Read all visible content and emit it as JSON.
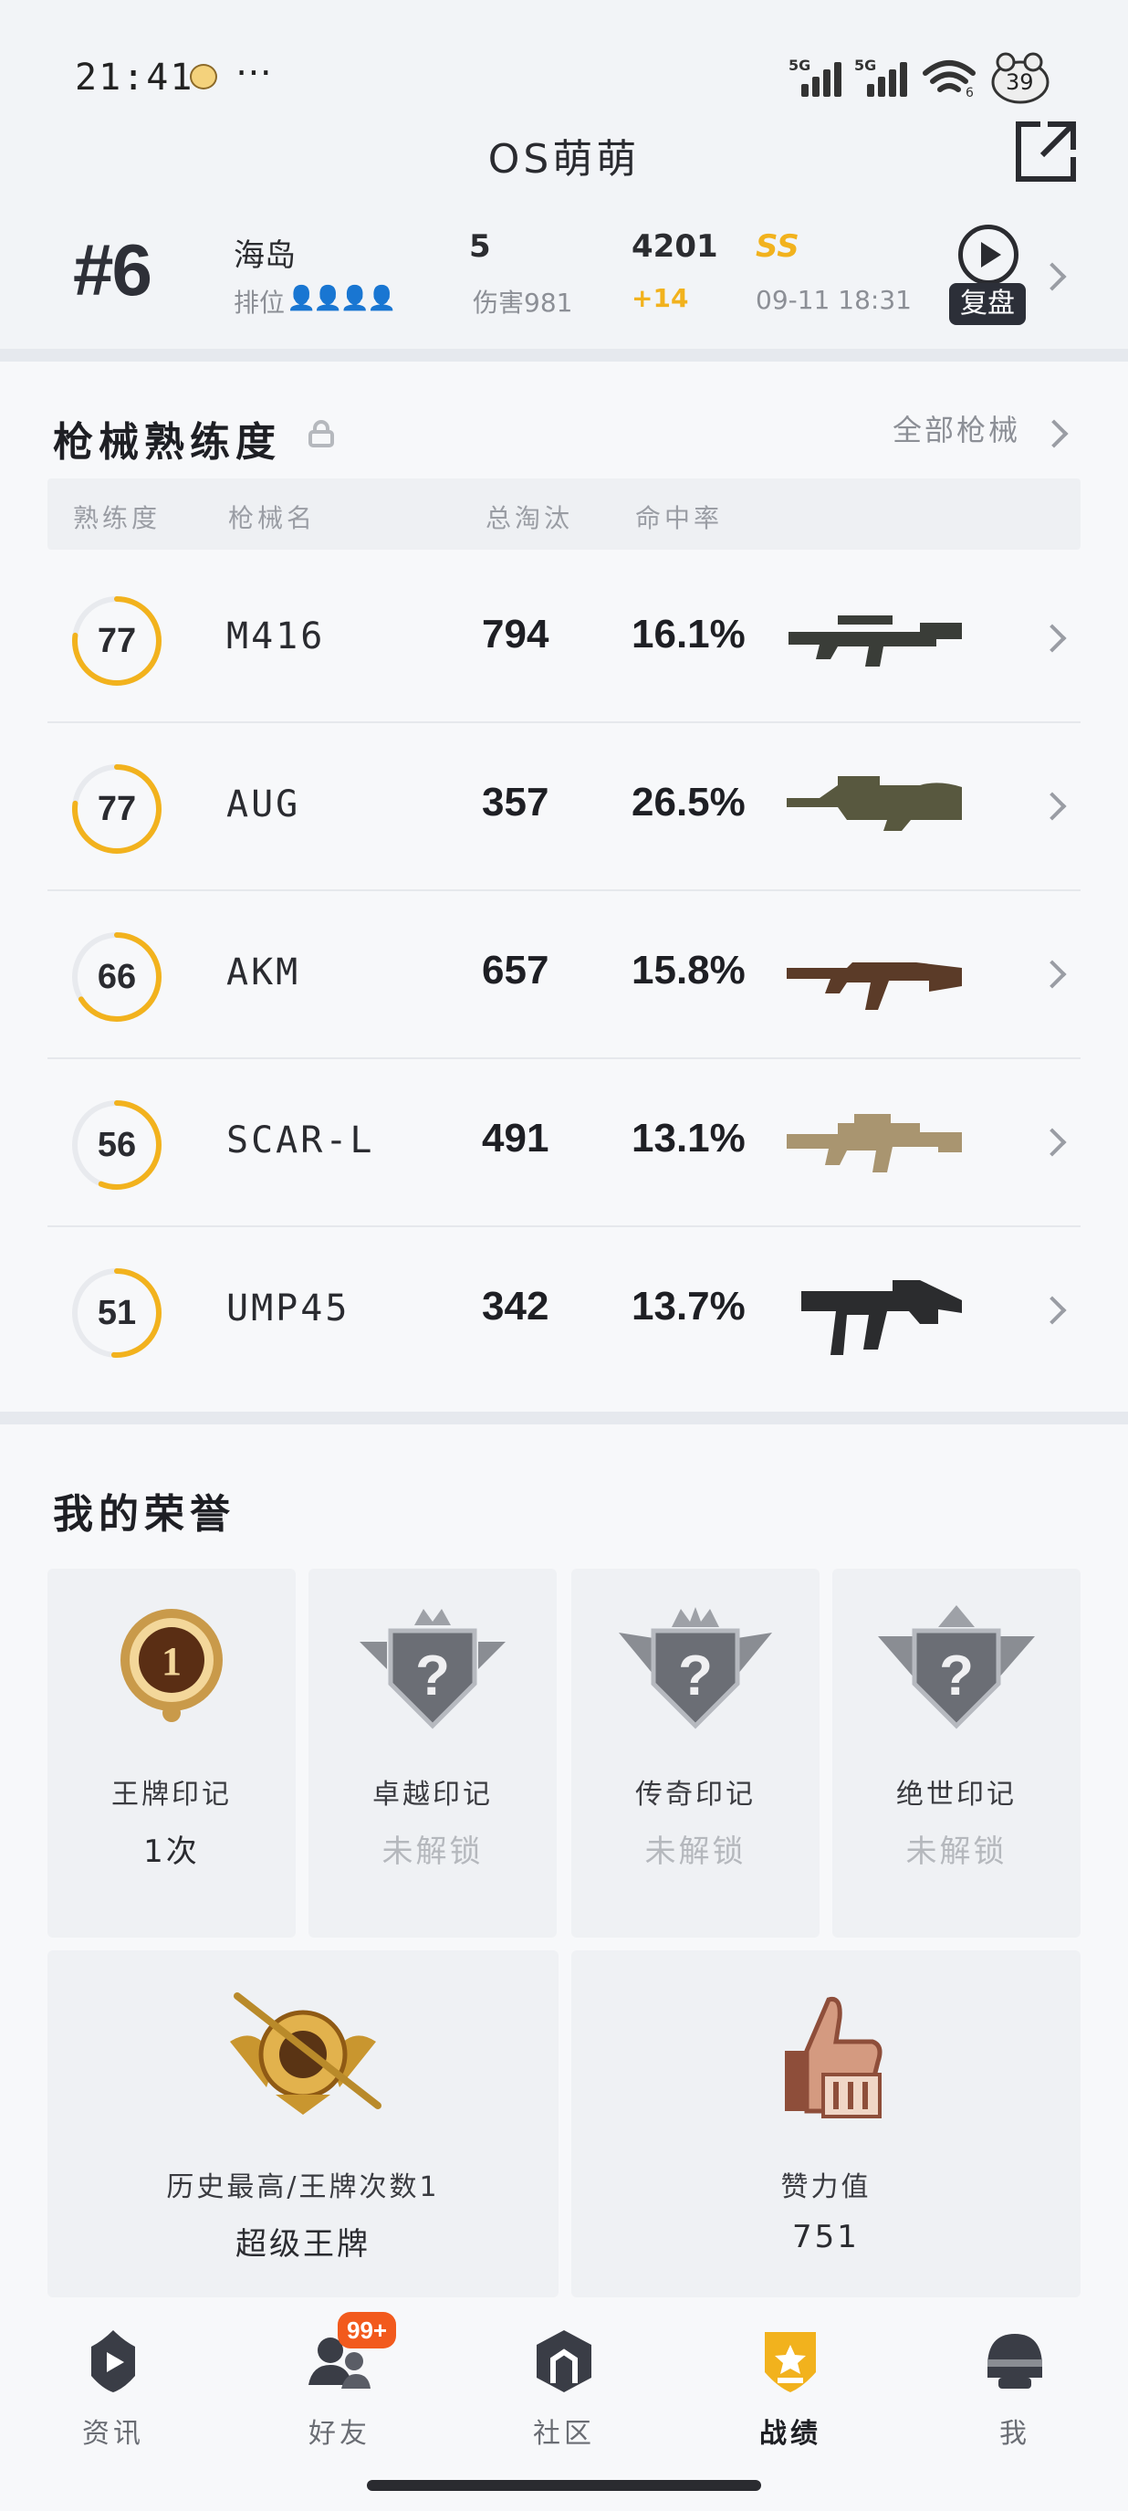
{
  "status_bar": {
    "time": "21:41",
    "dots": "⋯",
    "signal1_tag": "5G",
    "signal2_tag": "5G",
    "wifi_tag": "6",
    "battery": "39"
  },
  "header": {
    "title": "OS萌萌"
  },
  "recent_match": {
    "rank": "#6",
    "map": "海岛",
    "rank_label": "排位",
    "kills": "5",
    "damage": "伤害981",
    "score": "4201",
    "score_delta": "+14",
    "grade": "SS",
    "time": "09-11 18:31",
    "replay_label": "复盘"
  },
  "weapons": {
    "title": "枪械熟练度",
    "all_label": "全部枪械",
    "headers": {
      "proficiency": "熟练度",
      "name": "枪械名",
      "kills": "总淘汰",
      "accuracy": "命中率"
    },
    "rows": [
      {
        "proficiency": "77",
        "name": "M416",
        "kills": "794",
        "accuracy": "16.1%",
        "progress": 0.77,
        "gun_color": "#3a3d38"
      },
      {
        "proficiency": "77",
        "name": "AUG",
        "kills": "357",
        "accuracy": "26.5%",
        "progress": 0.77,
        "gun_color": "#58583f"
      },
      {
        "proficiency": "66",
        "name": "AKM",
        "kills": "657",
        "accuracy": "15.8%",
        "progress": 0.66,
        "gun_color": "#5b3b28"
      },
      {
        "proficiency": "56",
        "name": "SCAR-L",
        "kills": "491",
        "accuracy": "13.1%",
        "progress": 0.56,
        "gun_color": "#a99570"
      },
      {
        "proficiency": "51",
        "name": "UMP45",
        "kills": "342",
        "accuracy": "13.7%",
        "progress": 0.51,
        "gun_color": "#2b2c2e"
      }
    ]
  },
  "honors": {
    "title": "我的荣誉",
    "marks": [
      {
        "name": "王牌印记",
        "value": "1次",
        "locked": false
      },
      {
        "name": "卓越印记",
        "value": "未解锁",
        "locked": true
      },
      {
        "name": "传奇印记",
        "value": "未解锁",
        "locked": true
      },
      {
        "name": "绝世印记",
        "value": "未解锁",
        "locked": true
      }
    ],
    "highest": {
      "label": "历史最高/王牌次数1",
      "value": "超级王牌"
    },
    "likes": {
      "label": "赞力值",
      "value": "751"
    }
  },
  "bottom_nav": {
    "items": [
      {
        "label": "资讯"
      },
      {
        "label": "好友",
        "badge": "99+"
      },
      {
        "label": "社区"
      },
      {
        "label": "战绩",
        "active": true
      },
      {
        "label": "我"
      }
    ]
  },
  "colors": {
    "accent": "#f2b21d",
    "ring_track": "#e8eaee",
    "text": "#1e1f24"
  }
}
